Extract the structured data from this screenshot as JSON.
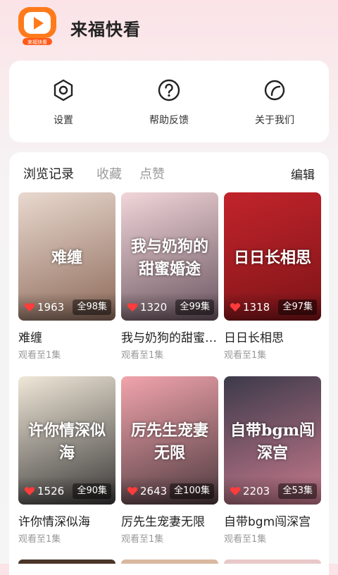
{
  "app": {
    "title": "来福快看",
    "logo_text": "来福快看"
  },
  "menu": [
    {
      "label": "设置",
      "icon": "gear-icon"
    },
    {
      "label": "帮助反馈",
      "icon": "help-icon"
    },
    {
      "label": "关于我们",
      "icon": "leaf-icon"
    }
  ],
  "tabs": [
    {
      "label": "浏览记录",
      "active": true
    },
    {
      "label": "收藏",
      "active": false
    },
    {
      "label": "点赞",
      "active": false
    }
  ],
  "edit_label": "编辑",
  "items": [
    {
      "title": "难缠",
      "progress": "观看至1集",
      "likes": "1963",
      "episodes": "全98集",
      "poster_text": "难缠",
      "color_top": "#e9d9cf",
      "color_bottom": "#8d6a5a"
    },
    {
      "title": "我与奶狗的甜蜜婚途",
      "progress": "观看至1集",
      "likes": "1320",
      "episodes": "全99集",
      "poster_text": "我与奶狗的甜蜜婚途",
      "color_top": "#f1d6d9",
      "color_bottom": "#6b5560"
    },
    {
      "title": "日日长相思",
      "progress": "观看至1集",
      "likes": "1318",
      "episodes": "全97集",
      "poster_text": "日日长相思",
      "color_top": "#c2242b",
      "color_bottom": "#7d1418"
    },
    {
      "title": "许你情深似海",
      "progress": "观看至1集",
      "likes": "1526",
      "episodes": "全90集",
      "poster_text": "许你情深似海",
      "color_top": "#f0e8d8",
      "color_bottom": "#3a3838"
    },
    {
      "title": "厉先生宠妻无限",
      "progress": "观看至1集",
      "likes": "2643",
      "episodes": "全100集",
      "poster_text": "厉先生宠妻无限",
      "color_top": "#f2a4ac",
      "color_bottom": "#4d3a3f"
    },
    {
      "title": "自带bgm闯深宫",
      "progress": "观看至1集",
      "likes": "2203",
      "episodes": "全53集",
      "poster_text": "自带bgm闯深宫",
      "color_top": "#3c3a4a",
      "color_bottom": "#c77a8d"
    }
  ],
  "colors": {
    "accent_red": "#ff3b3b",
    "logo_orange": "#ff7a1a",
    "tab_inactive": "#9a9a9a"
  }
}
